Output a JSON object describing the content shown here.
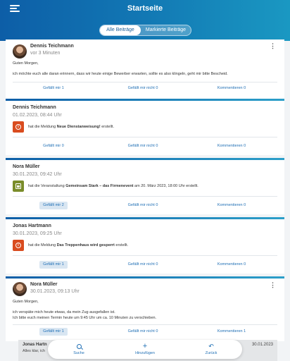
{
  "header": {
    "title": "Startseite",
    "tabs": [
      {
        "label": "Alle Beiträge",
        "active": true
      },
      {
        "label": "Markierte Beiträge",
        "active": false
      }
    ]
  },
  "posts": [
    {
      "author": "Dennis Teichmann",
      "time": "vor 3 Minuten",
      "greeting": "Guten Morgen,",
      "body": "ich möchte euch alle daran erinnern, dass wir heute einige Bewerber erwarten, sollte es also klingeln, geht mir bitte Bescheid.",
      "likes": "Gefällt mir 1",
      "dislikes": "Gefällt mir nicht 0",
      "comments": "Kommentieren 0"
    },
    {
      "author": "Dennis Teichmann",
      "time": "01.02.2023, 08:44 Uhr",
      "event_prefix": "hat die Meldung ",
      "event_bold": "Neue Dienstanweisung!",
      "event_suffix": " erstellt.",
      "likes": "Gefällt mir 0",
      "dislikes": "Gefällt mir nicht 0",
      "comments": "Kommentieren 0"
    },
    {
      "author": "Nora Müller",
      "time": "30.01.2023, 09:42 Uhr",
      "event_prefix": "hat die Veranstaltung ",
      "event_bold": "Gemeinsam Stark – das Firmenevent",
      "event_suffix": " am 20. März 2023, 18:00 Uhr erstellt.",
      "likes": "Gefällt mir 2",
      "dislikes": "Gefällt mir nicht 0",
      "comments": "Kommentieren 0"
    },
    {
      "author": "Jonas Hartmann",
      "time": "30.01.2023, 09:25 Uhr",
      "event_prefix": "hat die Meldung ",
      "event_bold": "Das Treppenhaus wird gesperrt",
      "event_suffix": " erstellt.",
      "likes": "Gefällt mir 1",
      "dislikes": "Gefällt mir nicht 0",
      "comments": "Kommentieren 0"
    },
    {
      "author": "Nora Müller",
      "time": "30.01.2023, 09:13 Uhr",
      "greeting": "Guten Morgen,",
      "body1": "ich verspäte mich heute etwas, da mein Zug ausgefallen ist.",
      "body2": "Ich bitte euch meinen Termin heute um 9:45 Uhr um ca. 10 Minuten zu verschieben.",
      "likes": "Gefällt mir 1",
      "dislikes": "Gefällt mir nicht 0",
      "comments": "Kommentieren 1"
    }
  ],
  "peek": {
    "author": "Jonas Hartn",
    "text": "Alles klar, ich",
    "date": "30.01.2023"
  },
  "tabbar": {
    "search": "Suche",
    "add": "Hinzufügen",
    "back": "Zurück"
  },
  "colors": {
    "header_start": "#0d5ea7",
    "header_end": "#1a98c2",
    "link": "#1f6fb5",
    "warn_icon": "#d94c1f",
    "event_icon": "#7a8c2a"
  }
}
